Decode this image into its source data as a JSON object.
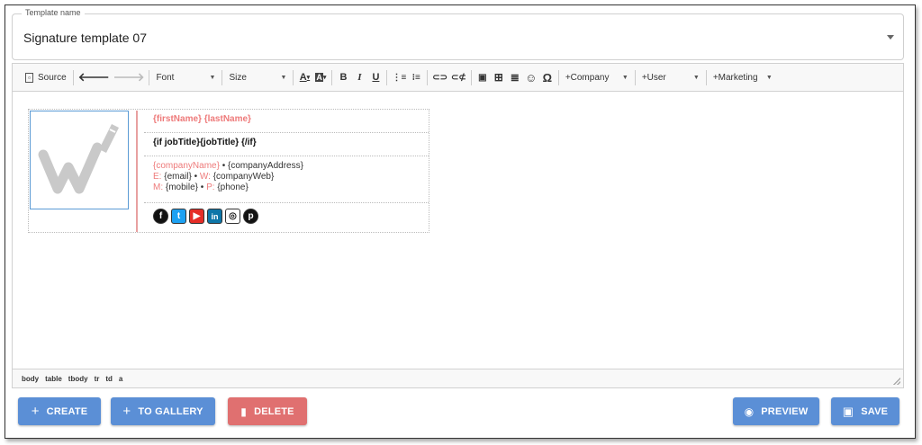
{
  "template_name": {
    "legend": "Template name",
    "value": "Signature template 07"
  },
  "toolbar": {
    "source_label": "Source",
    "font_label": "Font",
    "size_label": "Size",
    "company_label": "+Company",
    "user_label": "+User",
    "marketing_label": "+Marketing"
  },
  "signature": {
    "name_line": "{firstName} {lastName}",
    "job_line": "{if jobTitle}{jobTitle} {/if}",
    "company_name": "{companyName}",
    "company_sep": " • {companyAddress}",
    "email_prefix": "E:",
    "email_value": " {email} • ",
    "web_prefix": "W:",
    "web_value": " {companyWeb}",
    "mobile_prefix": "M:",
    "mobile_value": " {mobile} • ",
    "phone_prefix": "P:",
    "phone_value": " {phone}",
    "social_icons": [
      "facebook-icon",
      "twitter-icon",
      "youtube-icon",
      "linkedin-icon",
      "instagram-icon",
      "pinterest-icon"
    ]
  },
  "pathbar": [
    "body",
    "table",
    "tbody",
    "tr",
    "td",
    "a"
  ],
  "buttons": {
    "create": "CREATE",
    "gallery": "TO GALLERY",
    "delete": "DELETE",
    "preview": "PREVIEW",
    "save": "SAVE"
  },
  "colors": {
    "primary": "#5b8fd6",
    "danger": "#e07070",
    "accent_red": "#ee7a7a"
  }
}
